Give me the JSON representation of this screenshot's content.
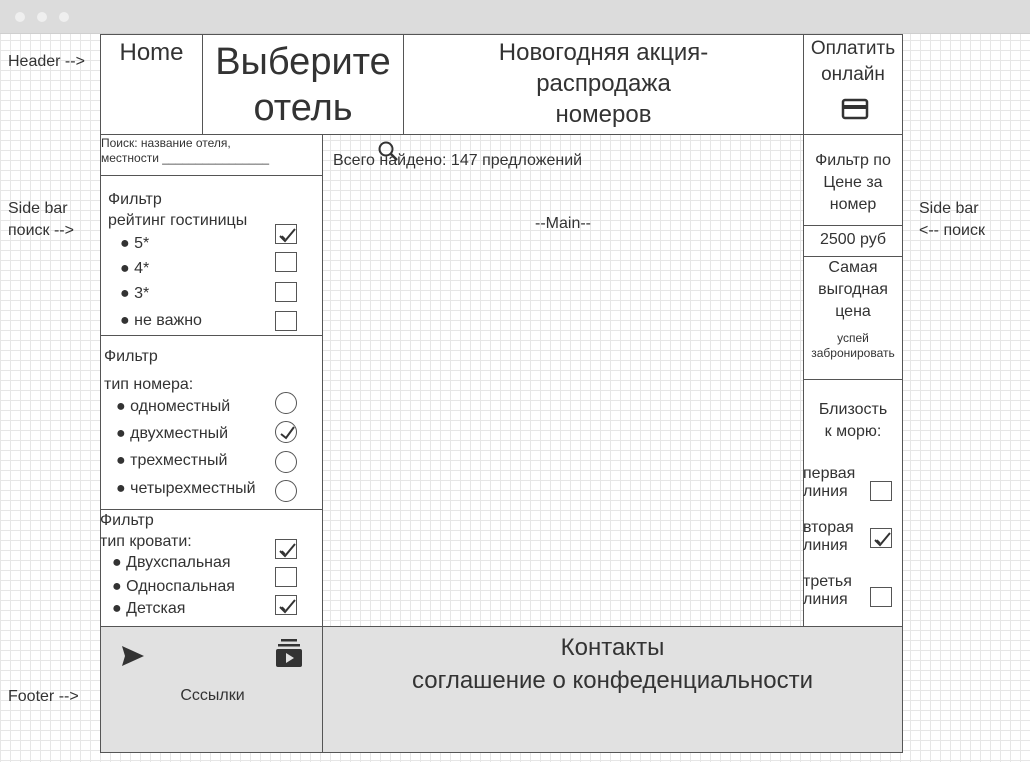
{
  "window": {
    "dots": [
      "#efefef",
      "#efefef",
      "#efefef"
    ]
  },
  "annotations": {
    "header": "Header -->",
    "left_sidebar": [
      "Side bar",
      "поиск -->"
    ],
    "right_sidebar": [
      "Side bar",
      "<-- поиск"
    ],
    "footer": "Footer -->"
  },
  "header": {
    "home": "Home",
    "choose_hotel": [
      "Выберите",
      "отель"
    ],
    "promo": [
      "Новогодняя акция-",
      "распродажа",
      "номеров"
    ],
    "pay": [
      "Оплатить",
      "онлайн"
    ],
    "pay_icon": "credit-card-icon"
  },
  "search": {
    "placeholder_lines": [
      "Поиск: название отеля,",
      "местности ________________"
    ],
    "icon": "search-icon"
  },
  "rating_filter": {
    "title": [
      "Фильтр",
      "рейтинг гостиницы"
    ],
    "items": [
      {
        "label": "5*",
        "checked": true
      },
      {
        "label": "4*",
        "checked": false
      },
      {
        "label": "3*",
        "checked": false
      },
      {
        "label": "не важно",
        "checked": false
      }
    ]
  },
  "room_filter": {
    "title": [
      "Фильтр",
      "тип номера:"
    ],
    "items": [
      {
        "label": "одноместный",
        "checked": false
      },
      {
        "label": "двухместный",
        "checked": true
      },
      {
        "label": "трехместный",
        "checked": false
      },
      {
        "label": "четырехместный",
        "checked": false
      }
    ]
  },
  "bed_filter": {
    "title": [
      "Фильтр",
      "тип кровати:"
    ],
    "items": [
      {
        "label": "Двухспальная",
        "checked": true
      },
      {
        "label": "Односпальная",
        "checked": false
      },
      {
        "label": "Детская",
        "checked": true
      }
    ]
  },
  "main": {
    "found": "Всего найдено: 147 предложений",
    "placeholder": "--Main--"
  },
  "price_filter": {
    "title": [
      "Фильтр по",
      "Цене за",
      "номер"
    ],
    "value": "2500 руб"
  },
  "best_price": {
    "title": [
      "Самая",
      "выгодная",
      "цена"
    ],
    "cta": [
      "успей",
      "забронировать"
    ]
  },
  "sea_filter": {
    "title": [
      "Близость",
      "к морю:"
    ],
    "items": [
      {
        "label": [
          "первая",
          "линия"
        ],
        "checked": false
      },
      {
        "label": [
          "вторая",
          "линия"
        ],
        "checked": true
      },
      {
        "label": [
          "третья",
          "линия"
        ],
        "checked": false
      }
    ]
  },
  "footer": {
    "send_icon": "send-icon",
    "subscriptions_icon": "subscriptions-icon",
    "links": "Сссылки",
    "contacts": "Контакты",
    "agreement": "соглашение о конфеденциальности"
  }
}
